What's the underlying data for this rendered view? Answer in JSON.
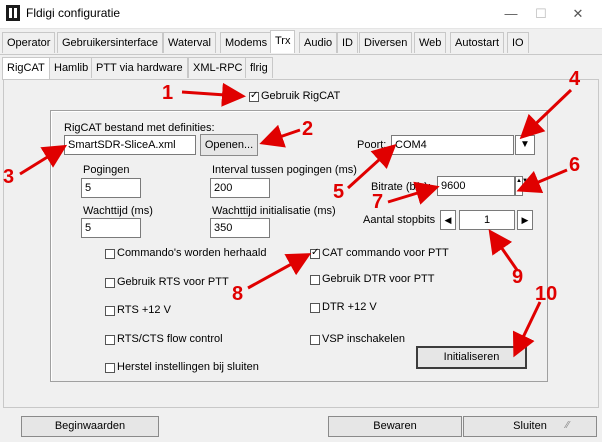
{
  "window": {
    "title": "Fldigi configuratie",
    "minimize": "—",
    "maximize": "☐",
    "close": "✕"
  },
  "main_tabs": [
    "Operator",
    "Gebruikersinterface",
    "Waterval",
    "Modems",
    "Trx",
    "Audio",
    "ID",
    "Diversen",
    "Web",
    "Autostart",
    "IO"
  ],
  "sub_tabs": [
    "RigCAT",
    "Hamlib",
    "PTT via hardware",
    "XML-RPC",
    "flrig"
  ],
  "rigcat": {
    "use_rigcat": "Gebruik RigCAT",
    "def_file_label": "RigCAT bestand met definities:",
    "def_file_value": "SmartSDR-SliceA.xml",
    "open_button": "Openen...",
    "port_label": "Poort:",
    "port_value": "COM4",
    "attempts_label": "Pogingen",
    "attempts_value": "5",
    "interval_label": "Interval tussen pogingen (ms)",
    "interval_value": "200",
    "bitrate_label": "Bitrate (b/s):",
    "bitrate_value": "9600",
    "wait_label": "Wachttijd (ms)",
    "wait_value": "5",
    "init_wait_label": "Wachttijd initialisatie (ms)",
    "init_wait_value": "350",
    "stopbits_label": "Aantal stopbits",
    "stopbits_value": "1",
    "opt_commands_repeated": "Commando's worden herhaald",
    "opt_cat_ptt": "CAT commando voor PTT",
    "opt_rts_ptt": "Gebruik RTS voor PTT",
    "opt_dtr_ptt": "Gebruik DTR voor PTT",
    "opt_rts12": "RTS +12 V",
    "opt_dtr12": "DTR +12 V",
    "opt_rtscts": "RTS/CTS flow control",
    "opt_vsp": "VSP inschakelen",
    "opt_restore": "Herstel instellingen bij sluiten",
    "init_button": "Initialiseren"
  },
  "checked": {
    "use_rigcat": true,
    "cat_ptt": true,
    "commands_repeated": false,
    "rts_ptt": false,
    "dtr_ptt": false,
    "rts12": false,
    "dtr12": false,
    "rtscts": false,
    "vsp": false,
    "restore": false
  },
  "bottom": {
    "defaults": "Beginwaarden",
    "save": "Bewaren",
    "close": "Sluiten"
  },
  "annotations": [
    "1",
    "2",
    "3",
    "4",
    "5",
    "6",
    "7",
    "8",
    "9",
    "10"
  ],
  "annotation_color": "#e00000"
}
